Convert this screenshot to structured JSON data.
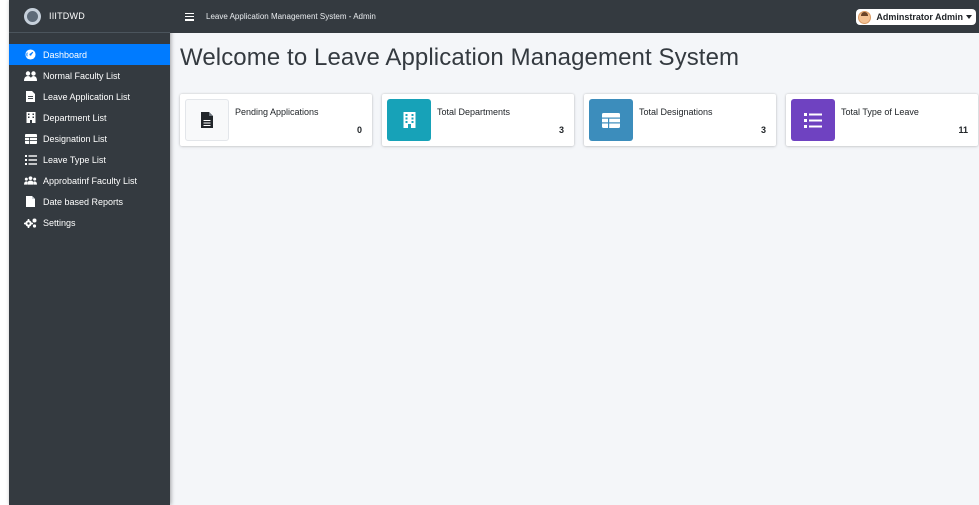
{
  "brand": {
    "name": "IIITDWD"
  },
  "topbar": {
    "title": "Leave Application Management System - Admin"
  },
  "user": {
    "name": "Adminstrator Admin"
  },
  "sidebar": {
    "items": [
      {
        "label": "Dashboard",
        "icon": "dashboard-icon",
        "active": true
      },
      {
        "label": "Normal Faculty List",
        "icon": "users-icon"
      },
      {
        "label": "Leave Application List",
        "icon": "file-icon"
      },
      {
        "label": "Department List",
        "icon": "building-icon"
      },
      {
        "label": "Designation List",
        "icon": "table-icon"
      },
      {
        "label": "Leave Type List",
        "icon": "list-icon"
      },
      {
        "label": "Approbatinf Faculty List",
        "icon": "users-group-icon"
      },
      {
        "label": "Date based Reports",
        "icon": "report-file-icon"
      },
      {
        "label": "Settings",
        "icon": "gears-icon"
      }
    ]
  },
  "main": {
    "heading": "Welcome to Leave Application Management System",
    "cards": [
      {
        "label": "Pending Applications",
        "value": "0",
        "icon": "file-icon",
        "color": "#f8f9fa"
      },
      {
        "label": "Total Departments",
        "value": "3",
        "icon": "building-icon",
        "color": "#17a2b8"
      },
      {
        "label": "Total Designations",
        "value": "3",
        "icon": "table-icon",
        "color": "#3c8dbc"
      },
      {
        "label": "Total Type of Leave",
        "value": "11",
        "icon": "list-icon",
        "color": "#6f42c1"
      }
    ]
  },
  "colors": {
    "sidebar": "#343a40",
    "active": "#007bff",
    "background": "#f4f6f9"
  }
}
